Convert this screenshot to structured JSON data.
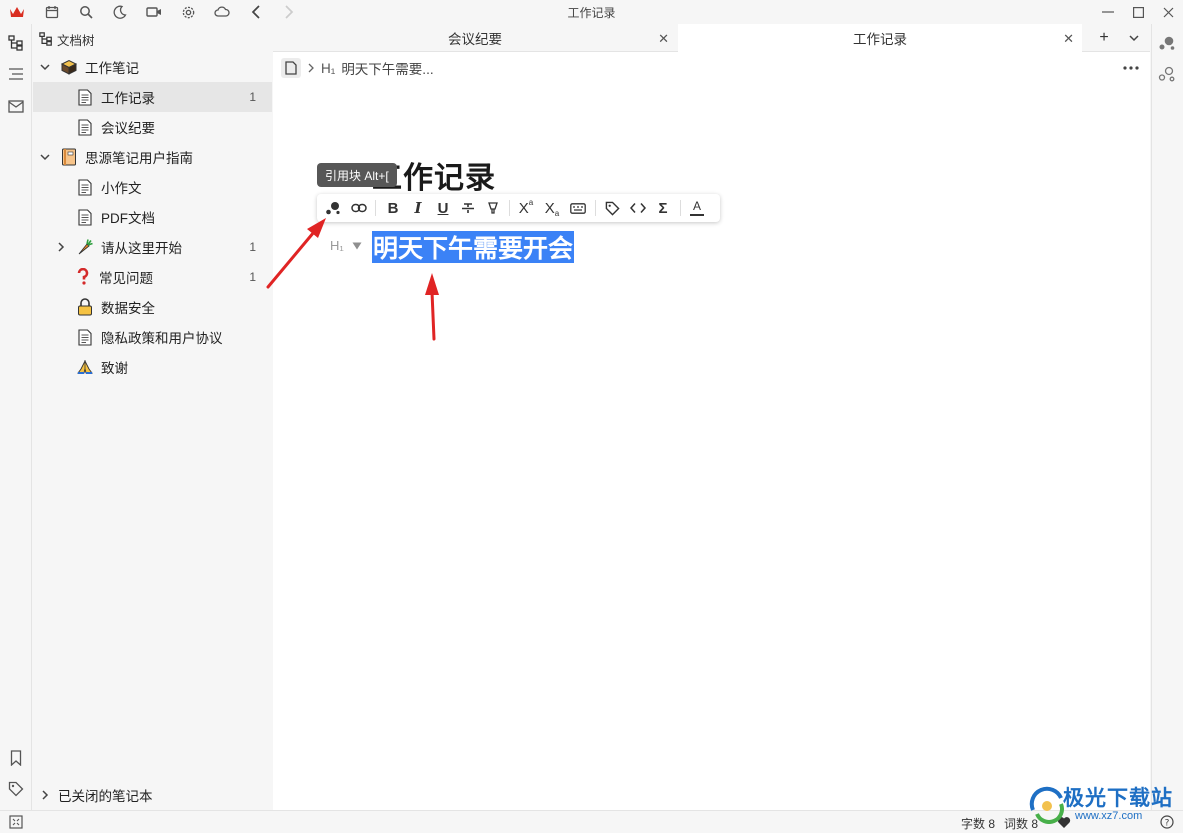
{
  "window": {
    "title": "工作记录",
    "minimize_icon": "minimize-icon",
    "maximize_icon": "maximize-icon",
    "close_icon": "close-icon"
  },
  "topbar": {
    "icons": [
      "crown-icon",
      "calendar-icon",
      "search-icon",
      "moon-icon",
      "video-icon",
      "gear-icon",
      "cloud-icon",
      "back-icon",
      "forward-icon"
    ]
  },
  "filetree": {
    "header": "文档树",
    "notebooks": [
      {
        "name": "工作笔记",
        "icon": "box-icon",
        "docs": [
          {
            "name": "工作记录",
            "count": "1",
            "active": true
          },
          {
            "name": "会议纪要",
            "count": ""
          }
        ]
      },
      {
        "name": "思源笔记用户指南",
        "icon": "book-icon",
        "docs": [
          {
            "name": "小作文",
            "count": ""
          },
          {
            "name": "PDF文档",
            "count": ""
          },
          {
            "name": "请从这里开始",
            "count": "1",
            "icon": "carrot-icon"
          },
          {
            "name": "常见问题",
            "count": "1",
            "icon": "question-icon"
          },
          {
            "name": "数据安全",
            "count": "",
            "icon": "lock-icon"
          },
          {
            "name": "隐私政策和用户协议",
            "count": ""
          },
          {
            "name": "致谢",
            "count": "",
            "icon": "pray-icon"
          }
        ]
      }
    ],
    "closed_notebooks": "已关闭的笔记本"
  },
  "tabs": [
    {
      "label": "会议纪要",
      "active": false
    },
    {
      "label": "工作记录",
      "active": true
    }
  ],
  "breadcrumb": {
    "level": "H₁",
    "text": "明天下午需要..."
  },
  "document": {
    "title": "工作记录",
    "block_type": "H₁",
    "heading_text": "明天下午需要开会"
  },
  "tooltip": "引用块 Alt+[",
  "format_toolbar": {
    "buttons": [
      "block-ref-icon",
      "link-icon",
      "bold-icon",
      "italic-icon",
      "underline-icon",
      "strikethrough-icon",
      "highlight-icon",
      "superscript-icon",
      "subscript-icon",
      "keyboard-icon",
      "tag-icon",
      "inline-code-icon",
      "math-icon",
      "text-color-icon"
    ],
    "bold_label": "B",
    "italic_label": "I",
    "underline_label": "U",
    "sup_label": "X",
    "sub_label": "X",
    "math_label": "Σ",
    "color_label": "A"
  },
  "statusbar": {
    "chars": "字数 8",
    "words": "词数 8"
  },
  "watermark": {
    "text": "极光下载站",
    "url": "www.xz7.com"
  },
  "colors": {
    "selection": "#3b82f6",
    "annotation_arrow": "#e02424",
    "watermark": "#1e6fc4"
  }
}
